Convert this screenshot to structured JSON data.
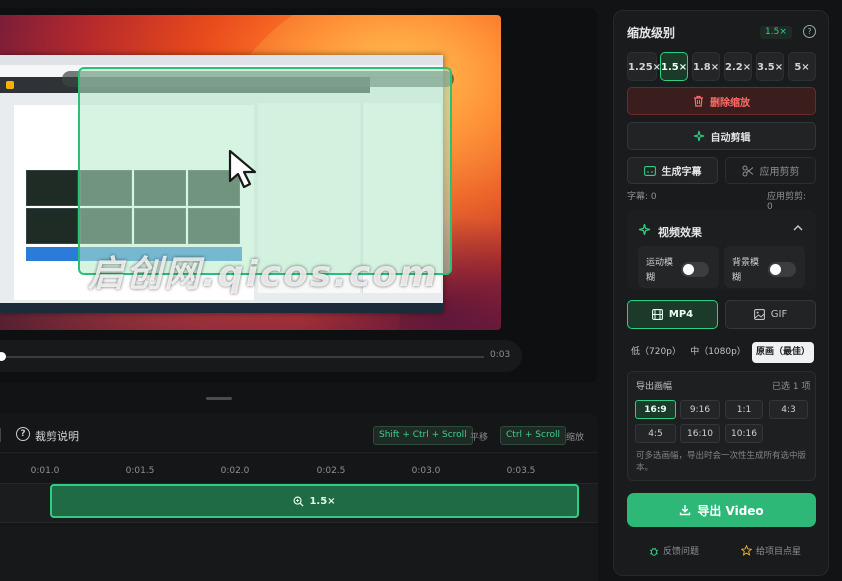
{
  "preview": {
    "watermark": "启创网.qicos.com",
    "time": "0:03"
  },
  "timeline": {
    "title": "裁剪说明",
    "shortcut_pan_keys": "Shift + Ctrl + Scroll",
    "shortcut_pan_label": "平移",
    "shortcut_zoom_keys": "Ctrl + Scroll",
    "shortcut_zoom_label": "缩放",
    "ticks": [
      "0:01.0",
      "0:01.5",
      "0:02.0",
      "0:02.5",
      "0:03.0",
      "0:03.5"
    ],
    "clip_label": "1.5×"
  },
  "zoom": {
    "title": "缩放级别",
    "current": "1.5×",
    "options": [
      "1.25×",
      "1.5×",
      "1.8×",
      "2.2×",
      "3.5×",
      "5×"
    ],
    "selected_index": 1
  },
  "actions": {
    "delete_zoom": "删除缩放",
    "auto_edit": "自动剪辑",
    "gen_subtitle": "生成字幕",
    "apply_clip": "应用剪剪",
    "subtitle_count": "字幕: 0",
    "clip_count": "应用剪剪: 0"
  },
  "effects": {
    "title": "视频效果",
    "motion_blur": "运动模糊",
    "bg_blur": "背景模糊",
    "motion_blur_on": false,
    "bg_blur_on": false
  },
  "export": {
    "format_mp4": "MP4",
    "format_gif": "GIF",
    "quality_low": "低（720p）",
    "quality_mid": "中（1080p）",
    "quality_orig": "原画（最佳）",
    "ratio_title": "导出画幅",
    "ratio_count": "已选 1 项",
    "ratios": [
      "16:9",
      "9:16",
      "1:1",
      "4:3",
      "4:5",
      "16:10",
      "10:16"
    ],
    "ratio_hint": "可多选画幅，导出时会一次性生成所有选中版本。",
    "export_button": "导出 Video",
    "feedback": "反馈问题",
    "star": "给项目点星"
  },
  "colors": {
    "accent": "#2fcf83",
    "danger": "#ff6b6b",
    "panel": "#1a1b1d"
  }
}
